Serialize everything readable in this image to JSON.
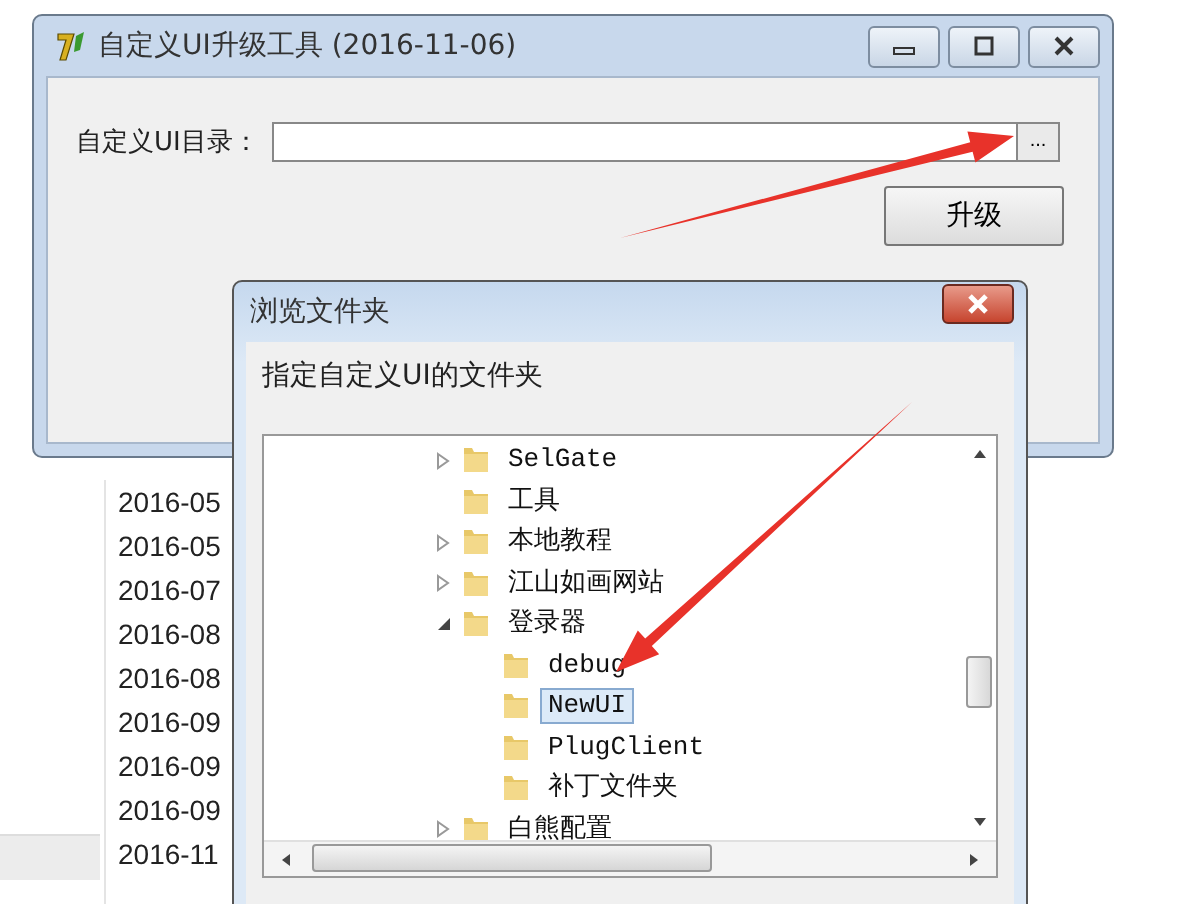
{
  "background_list": {
    "rows": [
      "2016-05",
      "2016-05",
      "2016-07",
      "2016-08",
      "2016-08",
      "2016-09",
      "2016-09",
      "2016-09",
      "2016-11"
    ]
  },
  "main_window": {
    "title": "自定义UI升级工具 (2016-11-06)",
    "directory_label": "自定义UI目录：",
    "browse_button": "...",
    "upgrade_button": "升级"
  },
  "dialog": {
    "title": "浏览文件夹",
    "prompt": "指定自定义UI的文件夹",
    "tree": [
      {
        "label": "SelGate",
        "expanded": false,
        "selected": false
      },
      {
        "label": "工具",
        "selected": false
      },
      {
        "label": "本地教程",
        "expanded": false,
        "selected": false
      },
      {
        "label": "江山如画网站",
        "expanded": false,
        "selected": false
      },
      {
        "label": "登录器",
        "expanded": true,
        "selected": false,
        "children": [
          {
            "label": "debug",
            "selected": false
          },
          {
            "label": "NewUI",
            "selected": true
          },
          {
            "label": "PlugClient",
            "selected": false
          },
          {
            "label": "补丁文件夹",
            "selected": false
          }
        ]
      },
      {
        "label": "白熊配置",
        "expanded": false,
        "selected": false
      }
    ]
  },
  "annotations": [
    {
      "kind": "arrow"
    },
    {
      "kind": "arrow"
    }
  ]
}
